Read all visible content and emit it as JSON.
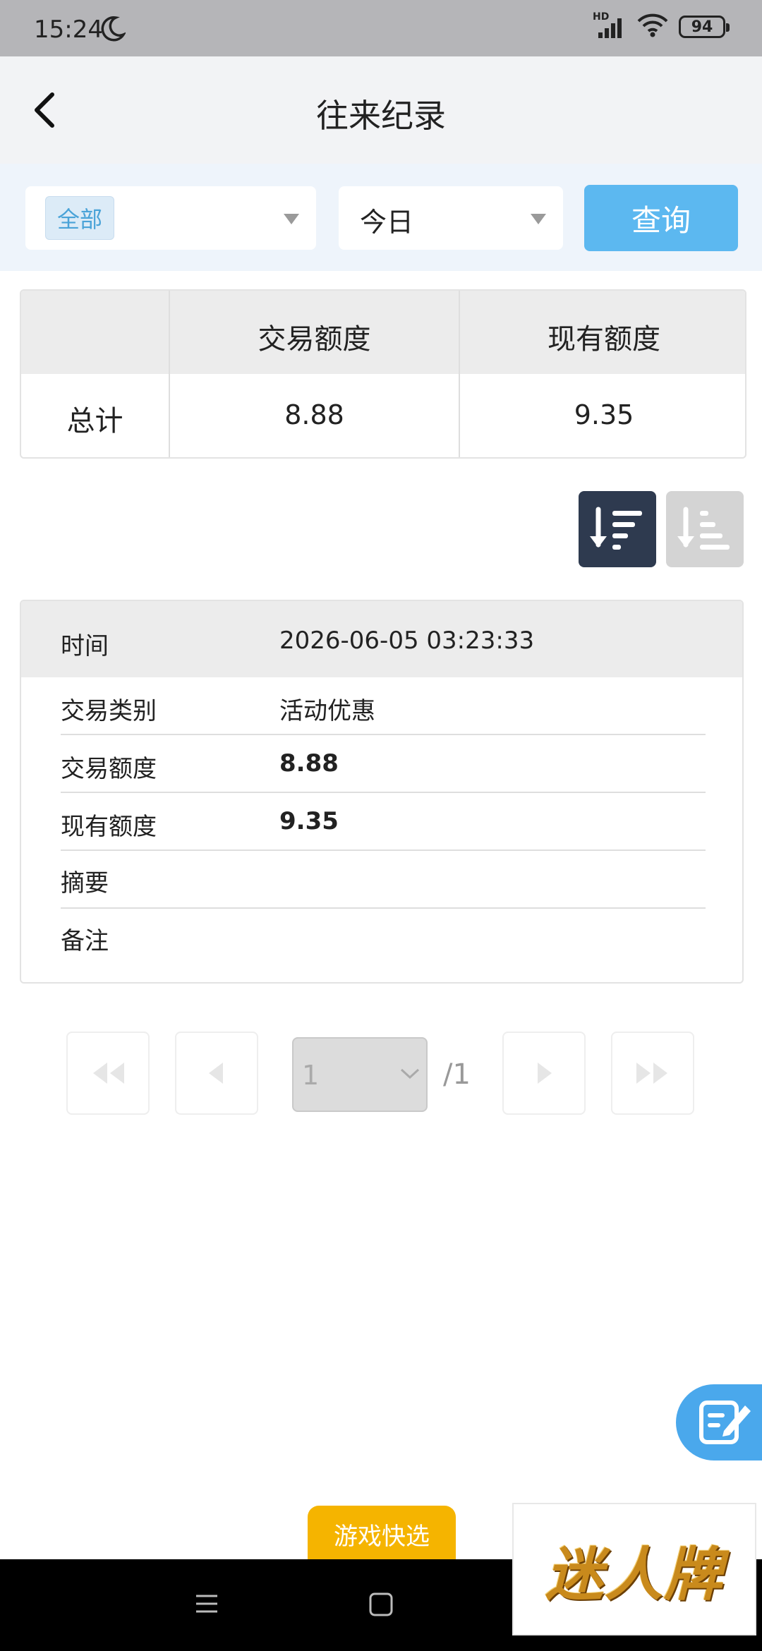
{
  "status_bar": {
    "time": "15:24",
    "battery": "94",
    "network_label": "HD"
  },
  "header": {
    "title": "往来纪录"
  },
  "filters": {
    "type_tag": "全部",
    "period_value": "今日",
    "query_label": "查询"
  },
  "summary": {
    "columns": [
      "交易额度",
      "现有额度"
    ],
    "row_label": "总计",
    "values": [
      "8.88",
      "9.35"
    ]
  },
  "record": {
    "time_label": "时间",
    "time_value": "2026-06-05 03:23:33",
    "rows": [
      {
        "label": "交易类别",
        "value": "活动优惠"
      },
      {
        "label": "交易额度",
        "value": "8.88"
      },
      {
        "label": "现有额度",
        "value": "9.35"
      },
      {
        "label": "摘要",
        "value": ""
      },
      {
        "label": "备注",
        "value": ""
      }
    ]
  },
  "pagination": {
    "current": "1",
    "total_text": "/1"
  },
  "quick_pick": {
    "label": "游戏快选"
  },
  "brand_logo": {
    "text": "迷人牌"
  },
  "colors": {
    "accent": "#5cb8f0",
    "sort_active": "#2e3a4f",
    "quick_pick": "#f5b400"
  }
}
